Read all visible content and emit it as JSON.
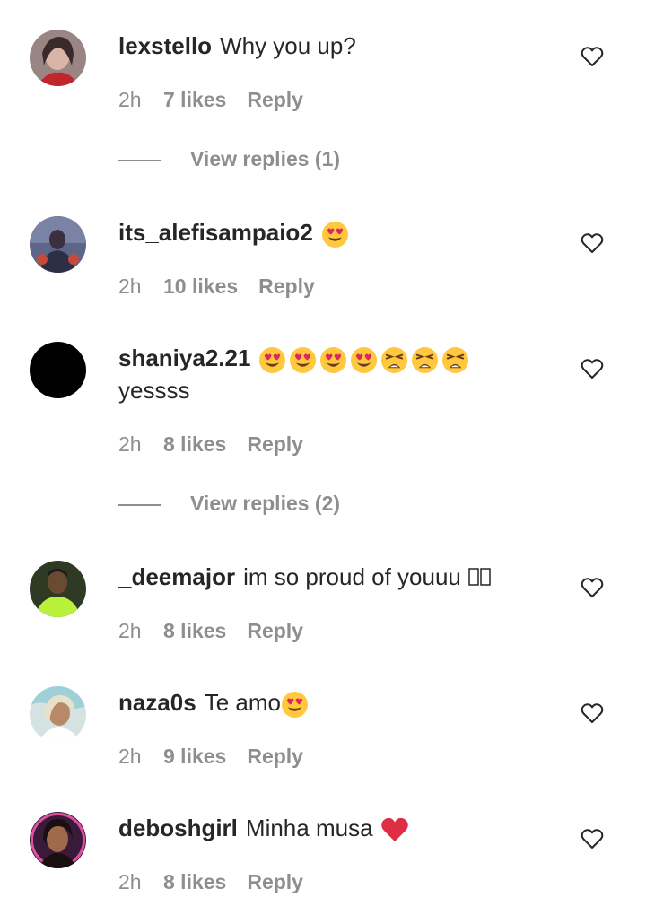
{
  "comments": [
    {
      "username": "lexstello",
      "text": "Why you up?",
      "time": "2h",
      "likes": "7 likes",
      "reply": "Reply",
      "view_replies": "View replies (1)",
      "avatar_color": "#8a6a6a"
    },
    {
      "username": "its_alefisampaio2",
      "text": "",
      "emojis": [
        "heart-eyes"
      ],
      "time": "2h",
      "likes": "10 likes",
      "reply": "Reply",
      "avatar_color": "#4a4f6e"
    },
    {
      "username": "shaniya2.21",
      "text": "yessss",
      "emojis": [
        "heart-eyes",
        "heart-eyes",
        "heart-eyes",
        "heart-eyes",
        "weary",
        "weary",
        "weary"
      ],
      "time": "2h",
      "likes": "8 likes",
      "reply": "Reply",
      "view_replies": "View replies (2)",
      "avatar_color": "#000000"
    },
    {
      "username": "_deemajor",
      "text": "im so proud of youuu",
      "time": "2h",
      "likes": "8 likes",
      "reply": "Reply",
      "avatar_color": "#3c4a2a"
    },
    {
      "username": "naza0s",
      "text": "Te amo",
      "emojis": [
        "heart-eyes"
      ],
      "time": "2h",
      "likes": "9 likes",
      "reply": "Reply",
      "avatar_color": "#c9d6d6"
    },
    {
      "username": "deboshgirl",
      "text": "Minha musa",
      "emojis": [
        "red-heart"
      ],
      "time": "2h",
      "likes": "8 likes",
      "reply": "Reply",
      "avatar_color": "#5a2a4a"
    }
  ],
  "colors": {
    "text": "#262626",
    "meta": "#8e8e8e",
    "emoji_yellow": "#ffc83d",
    "emoji_heart": "#e0245e"
  }
}
